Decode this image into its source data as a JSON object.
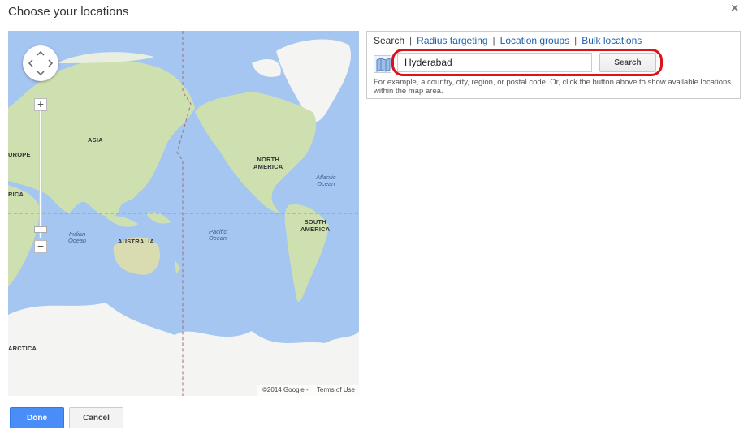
{
  "dialog": {
    "title": "Choose your locations",
    "close_glyph": "×"
  },
  "map": {
    "zoom_in": "+",
    "zoom_out": "−",
    "labels": {
      "europe": "UROPE",
      "asia": "ASIA",
      "africa": "RICA",
      "north_america": "NORTH\nAMERICA",
      "south_america": "SOUTH\nAMERICA",
      "australia": "AUSTRALIA",
      "antarctica": "ARCTICA"
    },
    "oceans": {
      "atlantic": "Atlantic\nOcean",
      "indian": "Indian\nOcean",
      "pacific": "Pacific\nOcean"
    },
    "attribution": "©2014 Google -",
    "terms": "Terms of Use",
    "colors": {
      "water": "#a6c6f2",
      "land": "#cfe0b0",
      "ice": "#f4f4f2"
    }
  },
  "search_panel": {
    "tabs": {
      "search": "Search",
      "radius": "Radius targeting",
      "groups": "Location groups",
      "bulk": "Bulk locations"
    },
    "separator": "|",
    "input_value": "Hyderabad",
    "search_button": "Search",
    "hint": "For example, a country, city, region, or postal code. Or, click the button above to show available locations within the map area.",
    "highlight_color": "#d9141c"
  },
  "footer": {
    "done": "Done",
    "cancel": "Cancel"
  }
}
